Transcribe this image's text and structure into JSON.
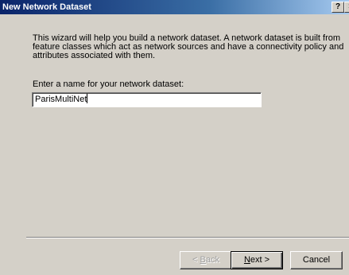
{
  "window": {
    "title": "New Network Dataset",
    "help_label": "?",
    "close_label": "×"
  },
  "content": {
    "description": "This wizard will help you build a network dataset.  A network dataset is built from feature classes which act as network sources and have a connectivity policy and attributes associated with them.",
    "name_label": "Enter a name for your network dataset:",
    "name_value": "ParisMultiNet"
  },
  "buttons": {
    "back": {
      "accel": "B",
      "rest": "ack",
      "prefix": "< "
    },
    "next": {
      "accel": "N",
      "rest": "ext >"
    },
    "cancel": "Cancel"
  }
}
